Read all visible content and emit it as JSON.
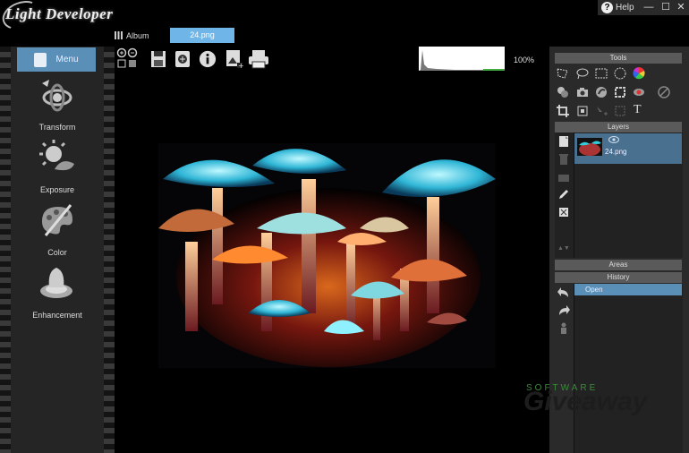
{
  "app": {
    "logo_text": "Light Developer"
  },
  "window_controls": {
    "help_label": "Help",
    "minimize": "—",
    "maximize": "☐",
    "close": "✕"
  },
  "tabs": {
    "album_label": "Album",
    "file_label": "24.png"
  },
  "left_menu": {
    "menu_label": "Menu",
    "items": [
      {
        "label": "Transform",
        "icon": "transform-icon"
      },
      {
        "label": "Exposure",
        "icon": "exposure-icon"
      },
      {
        "label": "Color",
        "icon": "color-palette-icon"
      },
      {
        "label": "Enhancement",
        "icon": "enhancement-icon"
      }
    ]
  },
  "toolbar": {
    "zoom_level": "100%",
    "icons": [
      "zoom-in-icon",
      "zoom-out-icon",
      "save-icon",
      "export-icon",
      "info-icon",
      "add-image-icon",
      "print-icon"
    ]
  },
  "right_panel": {
    "tools_header": "Tools",
    "layers_header": "Layers",
    "areas_header": "Areas",
    "history_header": "History",
    "layer_name": "24.png",
    "history_items": [
      "Open"
    ],
    "text_tool_glyph": "T"
  },
  "watermark": {
    "top": "SOFTWARE",
    "bottom": "Giveaway"
  },
  "colors": {
    "accent": "#5a8fb8",
    "tab_active": "#6fb5e8",
    "panel_bg": "#2a2a2a"
  }
}
